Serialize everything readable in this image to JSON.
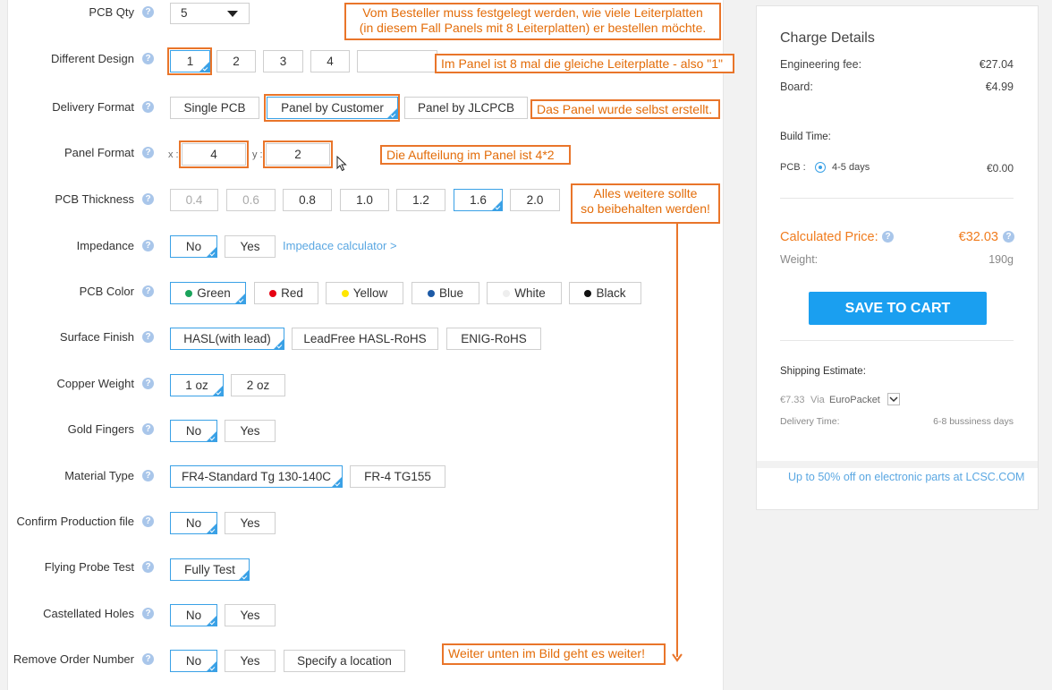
{
  "form": {
    "rows": {
      "pcb_qty": {
        "label": "PCB Qty",
        "value": "5"
      },
      "different_design": {
        "label": "Different Design",
        "options": [
          "1",
          "2",
          "3",
          "4"
        ]
      },
      "delivery_format": {
        "label": "Delivery Format",
        "options": [
          "Single PCB",
          "Panel by Customer",
          "Panel by JLCPCB"
        ]
      },
      "panel_format": {
        "label": "Panel Format",
        "x_label": "x :",
        "y_label": "y :",
        "x_value": "4",
        "y_value": "2"
      },
      "pcb_thickness": {
        "label": "PCB Thickness",
        "options": [
          "0.4",
          "0.6",
          "0.8",
          "1.0",
          "1.2",
          "1.6",
          "2.0"
        ]
      },
      "impedance": {
        "label": "Impedance",
        "options": [
          "No",
          "Yes"
        ],
        "link": "Impedace calculator >"
      },
      "pcb_color": {
        "label": "PCB Color",
        "options": [
          "Green",
          "Red",
          "Yellow",
          "Blue",
          "White",
          "Black"
        ]
      },
      "surface_finish": {
        "label": "Surface Finish",
        "options": [
          "HASL(with lead)",
          "LeadFree HASL-RoHS",
          "ENIG-RoHS"
        ]
      },
      "copper_weight": {
        "label": "Copper Weight",
        "options": [
          "1 oz",
          "2 oz"
        ]
      },
      "gold_fingers": {
        "label": "Gold Fingers",
        "options": [
          "No",
          "Yes"
        ]
      },
      "material_type": {
        "label": "Material Type",
        "options": [
          "FR4-Standard Tg 130-140C",
          "FR-4 TG155"
        ]
      },
      "confirm_production": {
        "label": "Confirm Production file",
        "options": [
          "No",
          "Yes"
        ]
      },
      "flying_probe": {
        "label": "Flying Probe Test",
        "options": [
          "Fully Test"
        ]
      },
      "castellated": {
        "label": "Castellated Holes",
        "options": [
          "No",
          "Yes"
        ]
      },
      "remove_order": {
        "label": "Remove Order Number",
        "options": [
          "No",
          "Yes",
          "Specify a location"
        ]
      }
    },
    "help_glyph": "?"
  },
  "colors": {
    "accent": "#3aa1e6",
    "annotation": "#e9752a",
    "green": "#1aa35b",
    "red": "#e60012",
    "yellow": "#ffe600",
    "blue": "#1d5aa6",
    "white": "#eeeeee",
    "black": "#111111",
    "button": "#1a9ff0",
    "price": "#f07c1e"
  },
  "annotations": {
    "a1": "Vom Besteller muss festgelegt werden, wie viele Leiterplatten",
    "a1b": "(in diesem Fall Panels mit 8 Leiterplatten) er bestellen möchte.",
    "a2": "Im Panel ist 8 mal die gleiche Leiterplatte - also \"1\"",
    "a3": "Das Panel wurde selbst erstellt.",
    "a4": "Die Aufteilung im Panel ist 4*2",
    "a5": "Alles weitere sollte",
    "a5b": "so beibehalten werden!",
    "a6": "Weiter unten im Bild geht es weiter!"
  },
  "sidebar": {
    "title": "Charge Details",
    "engineering_fee_label": "Engineering fee:",
    "engineering_fee": "€27.04",
    "board_label": "Board:",
    "board": "€4.99",
    "build_time_label": "Build Time:",
    "pcb_label": "PCB :",
    "build_option": "4-5 days",
    "build_price": "€0.00",
    "calc_label": "Calculated Price:",
    "calc_price": "€32.03",
    "weight_label": "Weight:",
    "weight": "190g",
    "save_button": "SAVE TO CART",
    "shipping_label": "Shipping Estimate:",
    "shipping_price": "€7.33",
    "via": "Via",
    "carrier": "EuroPacket",
    "delivery_label": "Delivery Time:",
    "delivery_time": "6-8 bussiness days",
    "promo": "Up to 50% off on electronic parts at LCSC.COM"
  }
}
